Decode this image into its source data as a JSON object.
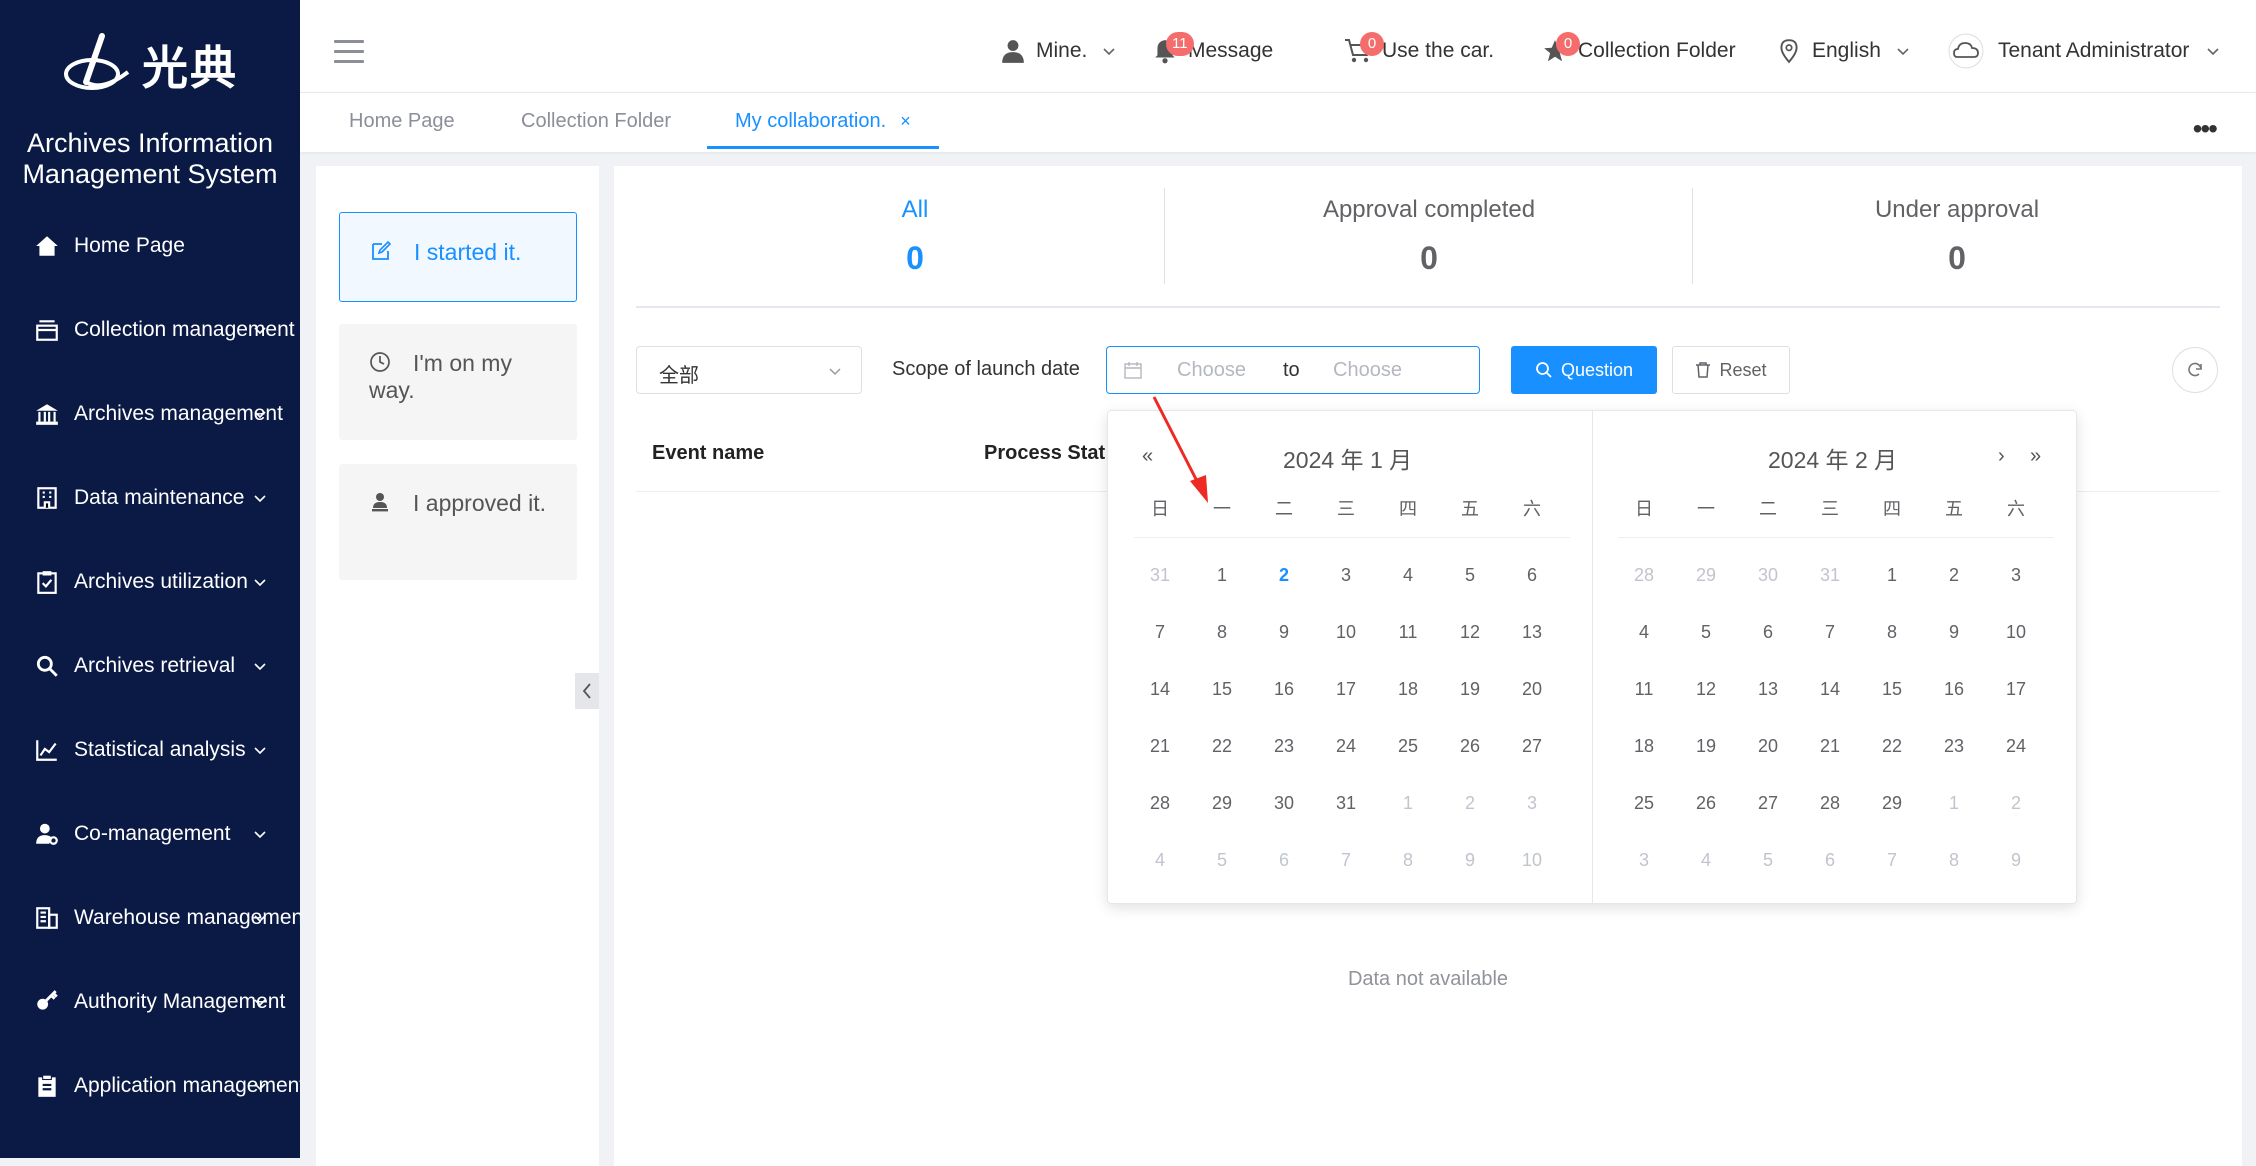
{
  "sidebar": {
    "logo_text": "光典",
    "title_line1": "Archives Information",
    "title_line2": "Management System",
    "items": [
      {
        "label": "Home Page",
        "icon": "home-icon",
        "chevron": false
      },
      {
        "label": "Collection management",
        "icon": "collection-icon",
        "chevron": true
      },
      {
        "label": "Archives management",
        "icon": "bank-icon",
        "chevron": true
      },
      {
        "label": "Data maintenance",
        "icon": "building-icon",
        "chevron": true
      },
      {
        "label": "Archives utilization",
        "icon": "clipboard-check-icon",
        "chevron": true
      },
      {
        "label": "Archives retrieval",
        "icon": "search-icon",
        "chevron": true
      },
      {
        "label": "Statistical analysis",
        "icon": "chart-icon",
        "chevron": true
      },
      {
        "label": "Co-management",
        "icon": "user-manage-icon",
        "chevron": true
      },
      {
        "label": "Warehouse management",
        "icon": "warehouse-icon",
        "chevron": true
      },
      {
        "label": "Authority Management",
        "icon": "key-icon",
        "chevron": true
      },
      {
        "label": "Application management",
        "icon": "clipboard-icon",
        "chevron": true
      }
    ]
  },
  "header": {
    "mine": "Mine.",
    "message": "Message",
    "message_badge": "11",
    "car": "Use the car.",
    "car_badge": "0",
    "collection": "Collection Folder",
    "collection_badge": "0",
    "language": "English",
    "user": "Tenant Administrator"
  },
  "tabs": [
    {
      "label": "Home Page",
      "active": false
    },
    {
      "label": "Collection Folder",
      "active": false
    },
    {
      "label": "My collaboration.",
      "active": true,
      "close": "×"
    }
  ],
  "left_panel": {
    "items": [
      {
        "label": "I started it.",
        "icon": "edit-icon",
        "active": true
      },
      {
        "label": "I'm on my way.",
        "icon": "clock-icon",
        "active": false
      },
      {
        "label": "I approved it.",
        "icon": "user-stamp-icon",
        "active": false
      }
    ]
  },
  "stats": [
    {
      "label": "All",
      "value": "0",
      "active": true
    },
    {
      "label": "Approval completed",
      "value": "0",
      "active": false
    },
    {
      "label": "Under approval",
      "value": "0",
      "active": false
    }
  ],
  "filters": {
    "select_value": "全部",
    "scope_label": "Scope of launch date",
    "start_placeholder": "Choose",
    "to": "to",
    "end_placeholder": "Choose",
    "query_button": "Question",
    "reset_button": "Reset"
  },
  "table": {
    "columns": [
      "Event name",
      "Process Stat"
    ],
    "empty_text": "Data not available"
  },
  "picker": {
    "left_title": "2024 年 1 月",
    "right_title": "2024 年 2 月",
    "weekdays": [
      "日",
      "一",
      "二",
      "三",
      "四",
      "五",
      "六"
    ],
    "nav_prev_year": "«",
    "nav_next_month": "›",
    "nav_next_year": "»",
    "left_days": [
      [
        {
          "d": "31",
          "m": 1
        },
        {
          "d": "1"
        },
        {
          "d": "2",
          "t": 1
        },
        {
          "d": "3"
        },
        {
          "d": "4"
        },
        {
          "d": "5"
        },
        {
          "d": "6"
        }
      ],
      [
        {
          "d": "7"
        },
        {
          "d": "8"
        },
        {
          "d": "9"
        },
        {
          "d": "10"
        },
        {
          "d": "11"
        },
        {
          "d": "12"
        },
        {
          "d": "13"
        }
      ],
      [
        {
          "d": "14"
        },
        {
          "d": "15"
        },
        {
          "d": "16"
        },
        {
          "d": "17"
        },
        {
          "d": "18"
        },
        {
          "d": "19"
        },
        {
          "d": "20"
        }
      ],
      [
        {
          "d": "21"
        },
        {
          "d": "22"
        },
        {
          "d": "23"
        },
        {
          "d": "24"
        },
        {
          "d": "25"
        },
        {
          "d": "26"
        },
        {
          "d": "27"
        }
      ],
      [
        {
          "d": "28"
        },
        {
          "d": "29"
        },
        {
          "d": "30"
        },
        {
          "d": "31"
        },
        {
          "d": "1",
          "m": 1
        },
        {
          "d": "2",
          "m": 1
        },
        {
          "d": "3",
          "m": 1
        }
      ],
      [
        {
          "d": "4",
          "m": 1
        },
        {
          "d": "5",
          "m": 1
        },
        {
          "d": "6",
          "m": 1
        },
        {
          "d": "7",
          "m": 1
        },
        {
          "d": "8",
          "m": 1
        },
        {
          "d": "9",
          "m": 1
        },
        {
          "d": "10",
          "m": 1
        }
      ]
    ],
    "right_days": [
      [
        {
          "d": "28",
          "m": 1
        },
        {
          "d": "29",
          "m": 1
        },
        {
          "d": "30",
          "m": 1
        },
        {
          "d": "31",
          "m": 1
        },
        {
          "d": "1"
        },
        {
          "d": "2"
        },
        {
          "d": "3"
        }
      ],
      [
        {
          "d": "4"
        },
        {
          "d": "5"
        },
        {
          "d": "6"
        },
        {
          "d": "7"
        },
        {
          "d": "8"
        },
        {
          "d": "9"
        },
        {
          "d": "10"
        }
      ],
      [
        {
          "d": "11"
        },
        {
          "d": "12"
        },
        {
          "d": "13"
        },
        {
          "d": "14"
        },
        {
          "d": "15"
        },
        {
          "d": "16"
        },
        {
          "d": "17"
        }
      ],
      [
        {
          "d": "18"
        },
        {
          "d": "19"
        },
        {
          "d": "20"
        },
        {
          "d": "21"
        },
        {
          "d": "22"
        },
        {
          "d": "23"
        },
        {
          "d": "24"
        }
      ],
      [
        {
          "d": "25"
        },
        {
          "d": "26"
        },
        {
          "d": "27"
        },
        {
          "d": "28"
        },
        {
          "d": "29"
        },
        {
          "d": "1",
          "m": 1
        },
        {
          "d": "2",
          "m": 1
        }
      ],
      [
        {
          "d": "3",
          "m": 1
        },
        {
          "d": "4",
          "m": 1
        },
        {
          "d": "5",
          "m": 1
        },
        {
          "d": "6",
          "m": 1
        },
        {
          "d": "7",
          "m": 1
        },
        {
          "d": "8",
          "m": 1
        },
        {
          "d": "9",
          "m": 1
        }
      ]
    ]
  },
  "colors": {
    "sidebar_bg": "#0a1a45",
    "accent": "#1890ff",
    "badge": "#f56c6c",
    "annotation_arrow": "#ee2a24"
  }
}
